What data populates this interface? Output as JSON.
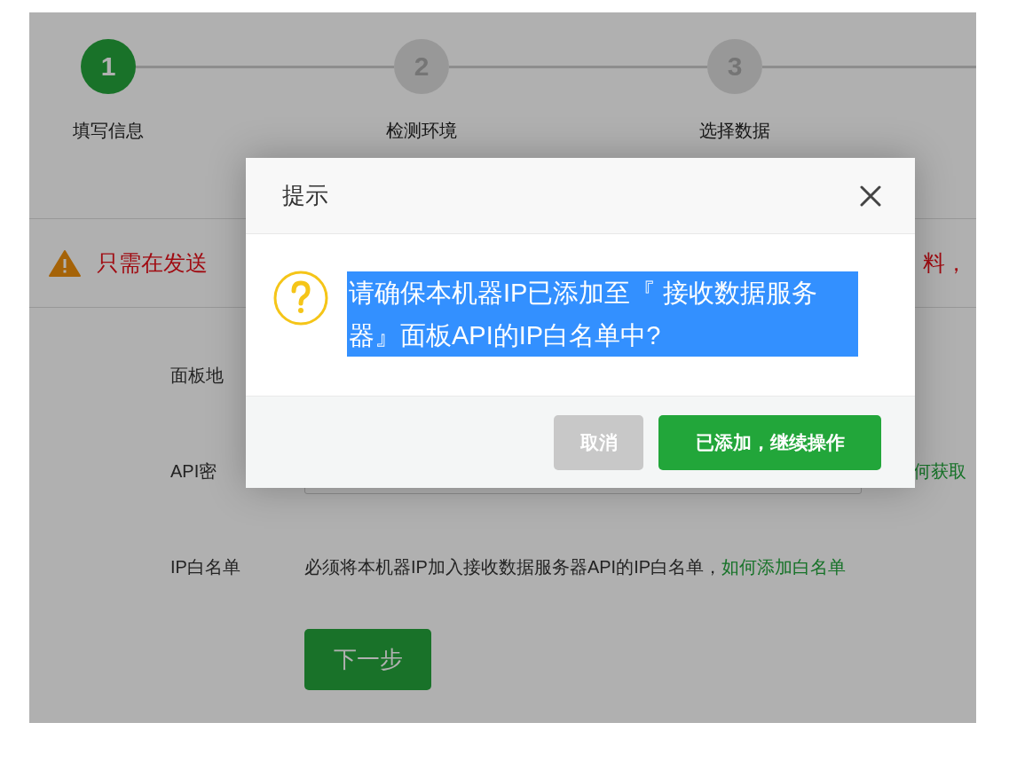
{
  "steps": [
    {
      "number": "1",
      "label": "填写信息",
      "active": true
    },
    {
      "number": "2",
      "label": "检测环境",
      "active": false
    },
    {
      "number": "3",
      "label": "选择数据",
      "active": false
    }
  ],
  "warning": {
    "text_left": "只需在发送",
    "text_right": "料，"
  },
  "form": {
    "rows": [
      {
        "kind": "label",
        "label": "面板地"
      },
      {
        "kind": "input",
        "label": "API密",
        "link": "何获取"
      },
      {
        "kind": "text",
        "label": "IP白名单",
        "text": "必须将本机器IP加入接收数据服务器API的IP白名单，",
        "link": "如何添加白名单"
      }
    ],
    "next_button": "下一步"
  },
  "dialog": {
    "title": "提示",
    "message": "请确保本机器IP已添加至『 接收数据服务器』面板API的IP白名单中?",
    "message_selected": true,
    "buttons": [
      {
        "kind": "cancel",
        "label": "取消"
      },
      {
        "kind": "confirm",
        "label": "已添加，继续操作"
      }
    ]
  }
}
